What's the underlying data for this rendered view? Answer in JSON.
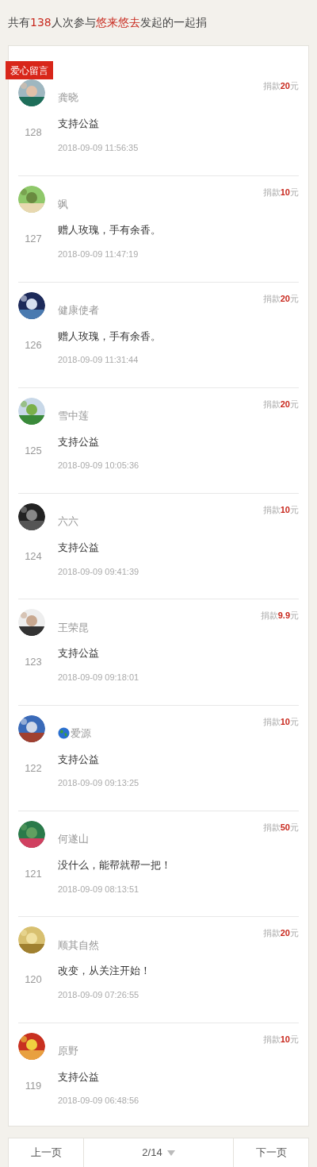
{
  "header": {
    "prefix": "共有",
    "count": "138",
    "middle": "人次参与",
    "organizer": "悠来悠去",
    "suffix": "发起的一起捐"
  },
  "tag": "爱心留言",
  "donations": [
    {
      "kind": "plain",
      "name": "龚晓",
      "number": "128",
      "message": "支持公益",
      "time": "2018-09-09 11:56:35",
      "amount_label": "捐款",
      "amount": "20",
      "unit": "元"
    },
    {
      "kind": "plain",
      "name": "飒",
      "number": "127",
      "message": "赠人玫瑰，手有余香。",
      "time": "2018-09-09 11:47:19",
      "amount_label": "捐款",
      "amount": "10",
      "unit": "元"
    },
    {
      "kind": "plain",
      "name": "健康使者",
      "number": "126",
      "message": "赠人玫瑰，手有余香。",
      "time": "2018-09-09 11:31:44",
      "amount_label": "捐款",
      "amount": "20",
      "unit": "元"
    },
    {
      "kind": "plain",
      "name": "雪中莲",
      "number": "125",
      "message": "支持公益",
      "time": "2018-09-09 10:05:36",
      "amount_label": "捐款",
      "amount": "20",
      "unit": "元"
    },
    {
      "kind": "plain",
      "name": "六六",
      "number": "124",
      "message": "支持公益",
      "time": "2018-09-09 09:41:39",
      "amount_label": "捐款",
      "amount": "10",
      "unit": "元"
    },
    {
      "kind": "plain",
      "name": "王荣昆",
      "number": "123",
      "message": "支持公益",
      "time": "2018-09-09 09:18:01",
      "amount_label": "捐款",
      "amount": "9.9",
      "unit": "元"
    },
    {
      "kind": "globe",
      "name": "爱源",
      "number": "122",
      "message": "支持公益",
      "time": "2018-09-09 09:13:25",
      "amount_label": "捐款",
      "amount": "10",
      "unit": "元"
    },
    {
      "kind": "plain",
      "name": "何遂山",
      "number": "121",
      "message": "没什么，能帮就帮一把！",
      "time": "2018-09-09 08:13:51",
      "amount_label": "捐款",
      "amount": "50",
      "unit": "元"
    },
    {
      "kind": "plain",
      "name": "顺其自然",
      "number": "120",
      "message": "改变，从关注开始！",
      "time": "2018-09-09 07:26:55",
      "amount_label": "捐款",
      "amount": "20",
      "unit": "元"
    },
    {
      "kind": "plain",
      "name": "原野",
      "number": "119",
      "message": "支持公益",
      "time": "2018-09-09 06:48:56",
      "amount_label": "捐款",
      "amount": "10",
      "unit": "元"
    }
  ],
  "pagination": {
    "prev": "上一页",
    "page": "2/14",
    "next": "下一页"
  }
}
